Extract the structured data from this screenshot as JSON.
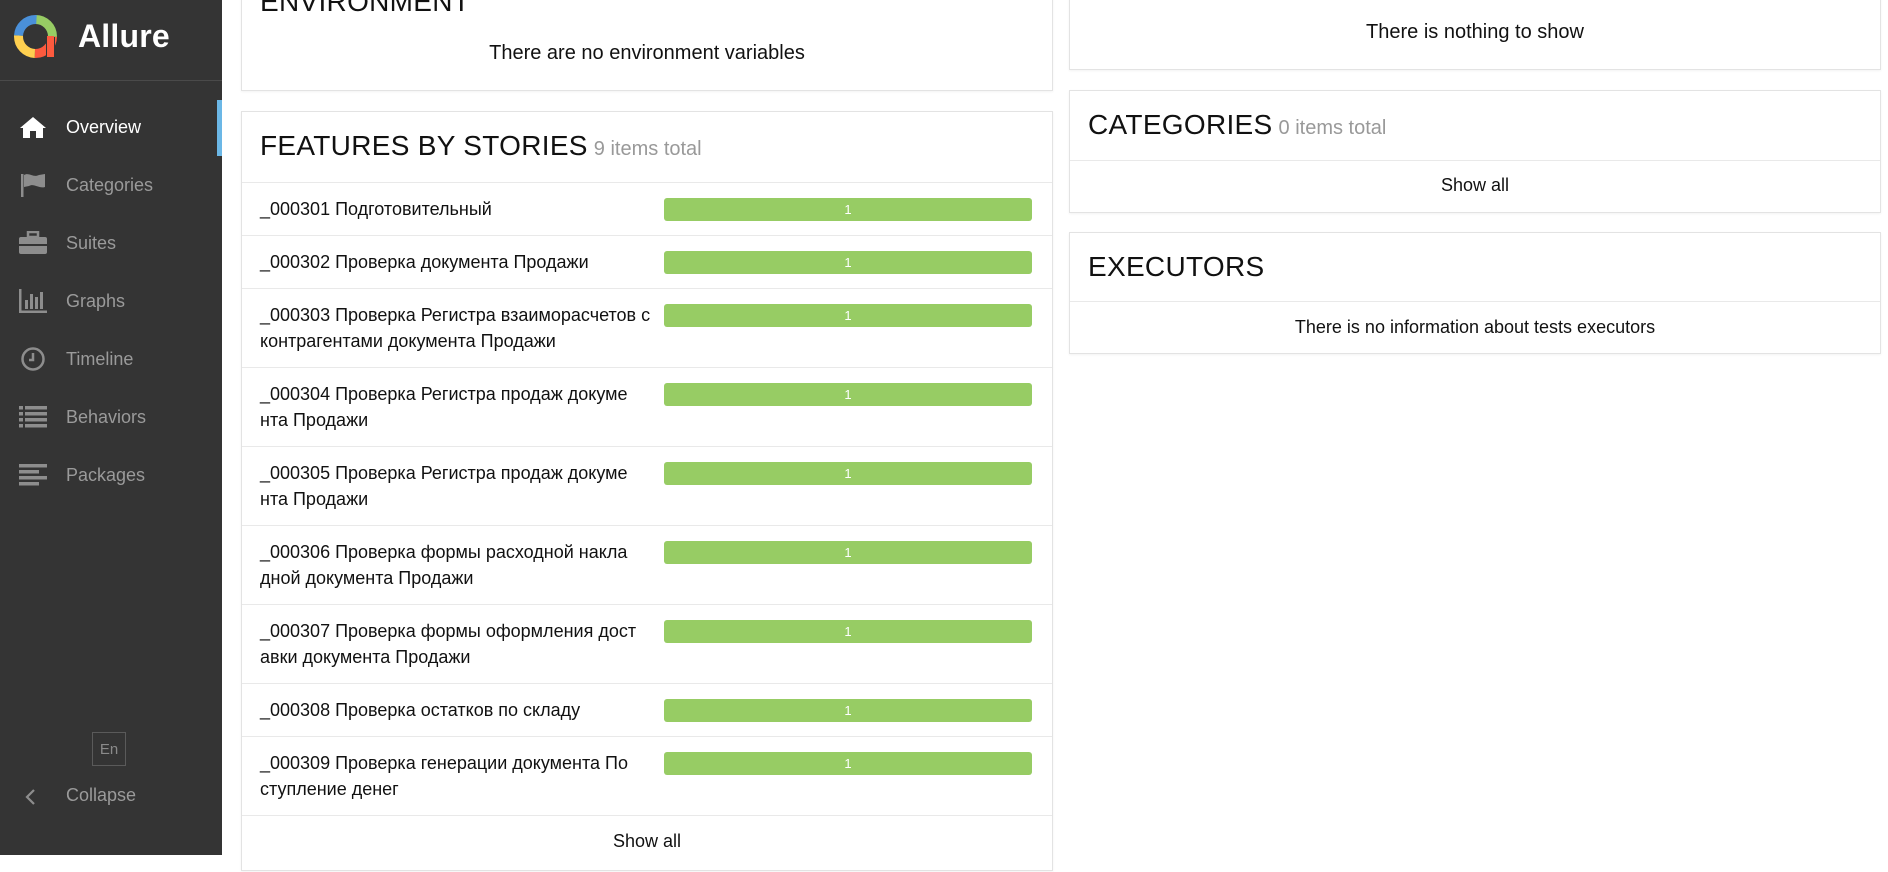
{
  "brand": {
    "title": "Allure",
    "logo_colors": [
      "#97cc64",
      "#fd5a3e",
      "#ffd050",
      "#4a90d9"
    ]
  },
  "sidebar": {
    "items": [
      {
        "label": "Overview",
        "icon": "home-icon",
        "active": true
      },
      {
        "label": "Categories",
        "icon": "flag-icon",
        "active": false
      },
      {
        "label": "Suites",
        "icon": "briefcase-icon",
        "active": false
      },
      {
        "label": "Graphs",
        "icon": "bar-chart-icon",
        "active": false
      },
      {
        "label": "Timeline",
        "icon": "clock-icon",
        "active": false
      },
      {
        "label": "Behaviors",
        "icon": "list-icon",
        "active": false
      },
      {
        "label": "Packages",
        "icon": "align-left-icon",
        "active": false
      }
    ],
    "language": "En",
    "collapse_label": "Collapse"
  },
  "environment": {
    "title": "ENVIRONMENT",
    "empty_text": "There are no environment variables"
  },
  "features": {
    "title": "FEATURES BY STORIES",
    "count_text": "9 items total",
    "rows": [
      {
        "name": "_000301 Подготовительный",
        "value": "1"
      },
      {
        "name": "_000302 Проверка документа Продажи",
        "value": "1"
      },
      {
        "name": "_000303 Проверка Регистра взаиморасчетов с контрагентами документа Продажи",
        "value": "1"
      },
      {
        "name": "_000304 Проверка Регистра продаж докуме нта Продажи",
        "value": "1"
      },
      {
        "name": "_000305 Проверка Регистра продаж докуме нта Продажи",
        "value": "1"
      },
      {
        "name": "_000306 Проверка формы расходной накла дной документа Продажи",
        "value": "1"
      },
      {
        "name": "_000307 Проверка формы оформления дост авки документа Продажи",
        "value": "1"
      },
      {
        "name": "_000308 Проверка остатков по складу",
        "value": "1"
      },
      {
        "name": "_000309 Проверка генерации документа По ступление денег",
        "value": "1"
      }
    ],
    "show_all": "Show all",
    "bar_color": "#97cc64"
  },
  "top_right": {
    "empty_text": "There is nothing to show"
  },
  "categories": {
    "title": "CATEGORIES",
    "count_text": "0 items total",
    "show_all": "Show all"
  },
  "executors": {
    "title": "EXECUTORS",
    "empty_text": "There is no information about tests executors"
  }
}
